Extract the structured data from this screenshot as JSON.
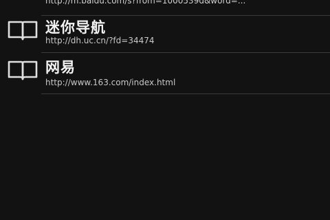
{
  "bookmarks": [
    {
      "title": "",
      "url": "http://m.baidu.com/s?from=1000539d&word=..."
    },
    {
      "title": "迷你导航",
      "url": "http://dh.uc.cn/?fd=34474",
      "icon": "book-icon"
    },
    {
      "title": "网易",
      "url": "http://www.163.com/index.html",
      "icon": "book-icon"
    }
  ],
  "colors": {
    "background": "#121212",
    "title_text": "#f2f2f2",
    "url_text": "#c8c8c8",
    "divider": "#3a3a3a"
  }
}
